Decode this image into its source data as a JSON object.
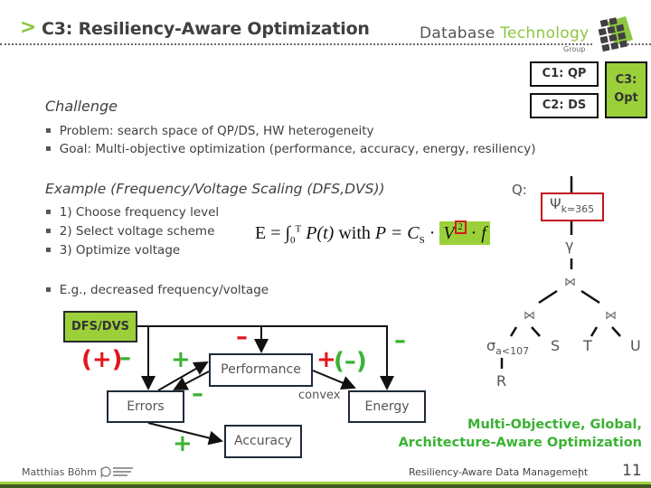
{
  "header": {
    "chevron": ">",
    "title": "C3: Resiliency-Aware Optimization",
    "brand_part1": "Database ",
    "brand_part2": "Technology",
    "brand_group": "Group"
  },
  "nav_boxes": {
    "c1": "C1: QP",
    "c2": "C2: DS",
    "c3_line1": "C3:",
    "c3_line2": "Opt"
  },
  "colors": {
    "accent_green": "#9bd03a",
    "highlight_red": "#c0161f",
    "positive_green": "#3ab233",
    "negative_red": "#e3161b"
  },
  "challenge": {
    "heading": "Challenge",
    "bullets": [
      "Problem: search space of QP/DS, HW heterogeneity",
      "Goal: Multi-objective optimization (performance, accuracy, energy, resiliency)"
    ]
  },
  "example": {
    "heading": "Example (Frequency/Voltage Scaling (DFS,DVS))",
    "steps": [
      "1) Choose frequency level",
      "2) Select voltage scheme",
      "3) Optimize voltage"
    ],
    "note": "E.g., decreased frequency/voltage"
  },
  "formula": {
    "lhs": "E = ",
    "integral": "∫",
    "lower": "0",
    "upper": "T",
    "integrand": "P(t)",
    "with": " with ",
    "rhs_p": "P = C",
    "rhs_sub": "S",
    "dot": " · ",
    "v": "V",
    "exponent": "2",
    "f": "f"
  },
  "query_tree": {
    "label": "Q:",
    "psi": "Ψ",
    "psi_sub": "k=365",
    "gamma": "γ",
    "join": "⋈",
    "sigma": "σ",
    "sigma_sub": "a<107",
    "leaves": [
      "S",
      "T",
      "U",
      "R"
    ]
  },
  "diagram": {
    "dfs": "DFS/DVS",
    "errors": "Errors",
    "performance": "Performance",
    "energy": "Energy",
    "accuracy": "Accuracy",
    "convex": "convex",
    "signs": {
      "errors_paren_plus": "(+)",
      "errors_minus": "–",
      "perf_minus": "–",
      "energy_minus": "–",
      "err_to_perf_plus": "+",
      "perf_to_err_minus": "–",
      "perf_to_energy_plus": "+",
      "perf_to_energy_paren_minus": "(–)",
      "err_to_acc_plus": "+"
    }
  },
  "callout": {
    "line1": "Multi-Objective, Global,",
    "line2": "Architecture-Aware Optimization"
  },
  "footer": {
    "author": "Matthias Böhm |",
    "center": "Resiliency-Aware Data Management",
    "separator": "|",
    "page": "11"
  }
}
